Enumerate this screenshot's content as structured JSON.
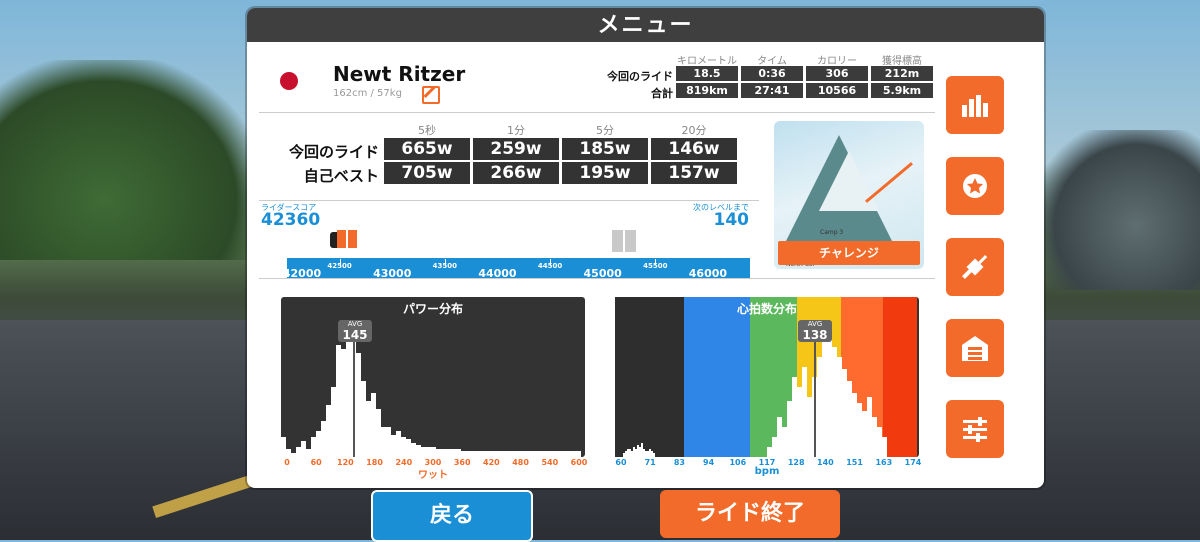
{
  "title": "メニュー",
  "profile": {
    "name": "Newt Ritzer",
    "height_weight": "162cm / 57kg"
  },
  "ride_stats": {
    "headers": [
      "キロメートル",
      "タイム",
      "カロリー",
      "獲得標高"
    ],
    "rows": [
      {
        "label": "今回のライド",
        "values": [
          "18.5",
          "0:36",
          "306",
          "212m"
        ]
      },
      {
        "label": "合計",
        "values": [
          "819km",
          "27:41",
          "10566",
          "5.9km"
        ]
      }
    ]
  },
  "power_best": {
    "headers": [
      "5秒",
      "1分",
      "5分",
      "20分"
    ],
    "rows": [
      {
        "label": "今回のライド",
        "values": [
          "665w",
          "259w",
          "185w",
          "146w"
        ]
      },
      {
        "label": "自己ベスト",
        "values": [
          "705w",
          "266w",
          "195w",
          "157w"
        ]
      }
    ]
  },
  "challenge_button": "チャレンジ",
  "map": {
    "labels": [
      "Camp 3",
      "North Col"
    ]
  },
  "progress": {
    "score_label": "ライダースコア",
    "score": "42360",
    "next_label": "次のレベルまで",
    "next": "140",
    "scale_major": [
      "42000",
      "43000",
      "44000",
      "45000",
      "46000"
    ],
    "scale_minor": [
      "42500",
      "43500",
      "44500",
      "45500"
    ]
  },
  "power_hist": {
    "title": "パワー分布",
    "avg_label": "AVG",
    "avg": "145",
    "xticks": [
      "0",
      "60",
      "120",
      "180",
      "240",
      "300",
      "360",
      "420",
      "480",
      "540",
      "600"
    ],
    "xlabel": "ワット"
  },
  "hr_hist": {
    "title": "心拍数分布",
    "avg_label": "AVG",
    "avg": "138",
    "xticks": [
      "60",
      "71",
      "83",
      "94",
      "106",
      "117",
      "128",
      "140",
      "151",
      "163",
      "174"
    ],
    "xlabel": "bpm",
    "zone_colors": [
      "#2e2e2e",
      "#2f86e6",
      "#5cb85c",
      "#f5c518",
      "#ff6b2e",
      "#f23a0f"
    ]
  },
  "side_buttons": [
    "chart-icon",
    "badge-icon",
    "plug-icon",
    "garage-icon",
    "sliders-icon"
  ],
  "buttons": {
    "back": "戻る",
    "end_ride": "ライド終了"
  },
  "colors": {
    "accent": "#f26b2a",
    "blue": "#1a8fd6",
    "dark": "#333333"
  }
}
